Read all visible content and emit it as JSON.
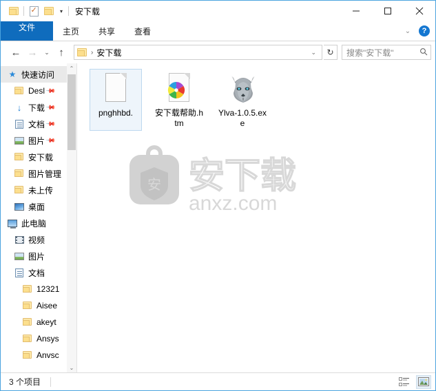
{
  "window": {
    "title": "安下载",
    "quick_access_toolbar": [
      {
        "name": "folder-properties-icon",
        "label": "属性"
      },
      {
        "name": "new-folder-icon",
        "label": "新建文件夹"
      },
      {
        "name": "customize-caret",
        "label": "▾"
      }
    ],
    "controls": {
      "minimize": "—",
      "maximize": "□",
      "close": "✕"
    }
  },
  "ribbon": {
    "tabs": [
      {
        "label": "文件",
        "active": true
      },
      {
        "label": "主页",
        "active": false
      },
      {
        "label": "共享",
        "active": false
      },
      {
        "label": "查看",
        "active": false
      }
    ],
    "collapse_caret": "⌄",
    "help_label": "?"
  },
  "navbar": {
    "back": "←",
    "forward": "→",
    "history": "⌄",
    "up": "↑",
    "breadcrumb": {
      "separator": "›",
      "path": "安下载"
    },
    "address_caret": "⌄",
    "refresh": "↻",
    "search_placeholder": "搜索\"安下载\""
  },
  "sidebar": {
    "groups": [
      {
        "header": {
          "label": "快速访问",
          "icon": "pin-star-icon",
          "selected": true
        },
        "items": [
          {
            "label": "Desl",
            "icon": "folder-icon",
            "pinned": true,
            "indent": 1
          },
          {
            "label": "下载",
            "icon": "download-arrow-icon",
            "pinned": true,
            "indent": 1
          },
          {
            "label": "文档",
            "icon": "documents-icon",
            "pinned": true,
            "indent": 1
          },
          {
            "label": "图片",
            "icon": "pictures-icon",
            "pinned": true,
            "indent": 1
          },
          {
            "label": "安下载",
            "icon": "folder-icon",
            "pinned": false,
            "indent": 1
          },
          {
            "label": "图片管理",
            "icon": "folder-icon",
            "pinned": false,
            "indent": 1
          },
          {
            "label": "未上传",
            "icon": "folder-icon",
            "pinned": false,
            "indent": 1
          },
          {
            "label": "桌面",
            "icon": "desktop-icon",
            "pinned": false,
            "indent": 1
          }
        ]
      },
      {
        "header": {
          "label": "此电脑",
          "icon": "this-pc-icon",
          "selected": false
        },
        "items": [
          {
            "label": "视频",
            "icon": "videos-icon",
            "pinned": false,
            "indent": 1
          },
          {
            "label": "图片",
            "icon": "pictures-icon",
            "pinned": false,
            "indent": 1
          },
          {
            "label": "文档",
            "icon": "documents-icon",
            "pinned": false,
            "indent": 1
          },
          {
            "label": "12321",
            "icon": "folder-icon",
            "pinned": false,
            "indent": 2
          },
          {
            "label": "Aisee",
            "icon": "folder-icon",
            "pinned": false,
            "indent": 2
          },
          {
            "label": "akeyt",
            "icon": "folder-icon",
            "pinned": false,
            "indent": 2
          },
          {
            "label": "Ansys",
            "icon": "folder-icon",
            "pinned": false,
            "indent": 2
          },
          {
            "label": "Anvsc",
            "icon": "folder-icon",
            "pinned": false,
            "indent": 2
          }
        ]
      }
    ],
    "scrollbar": {
      "up": "⌃",
      "down": "⌄"
    }
  },
  "files": [
    {
      "name": "pnghhbd.",
      "icon": "blank-document-icon",
      "selected": true
    },
    {
      "name": "安下载帮助.htm",
      "icon": "html-document-icon",
      "selected": false
    },
    {
      "name": "Ylva-1.0.5.exe",
      "icon": "wolf-application-icon",
      "selected": false
    }
  ],
  "watermark": {
    "logo_char": "安",
    "brand": "安下载",
    "site": "anxz.com"
  },
  "statusbar": {
    "item_count": "3 个项目",
    "views": [
      {
        "name": "details-view-button",
        "label": "详细信息",
        "active": false
      },
      {
        "name": "large-icons-view-button",
        "label": "大图标",
        "active": true
      }
    ]
  },
  "colors": {
    "accent": "#0f6cbd",
    "window_border": "#4aa3df",
    "selection": "#eef5fb",
    "folder": "#fde9a9"
  }
}
